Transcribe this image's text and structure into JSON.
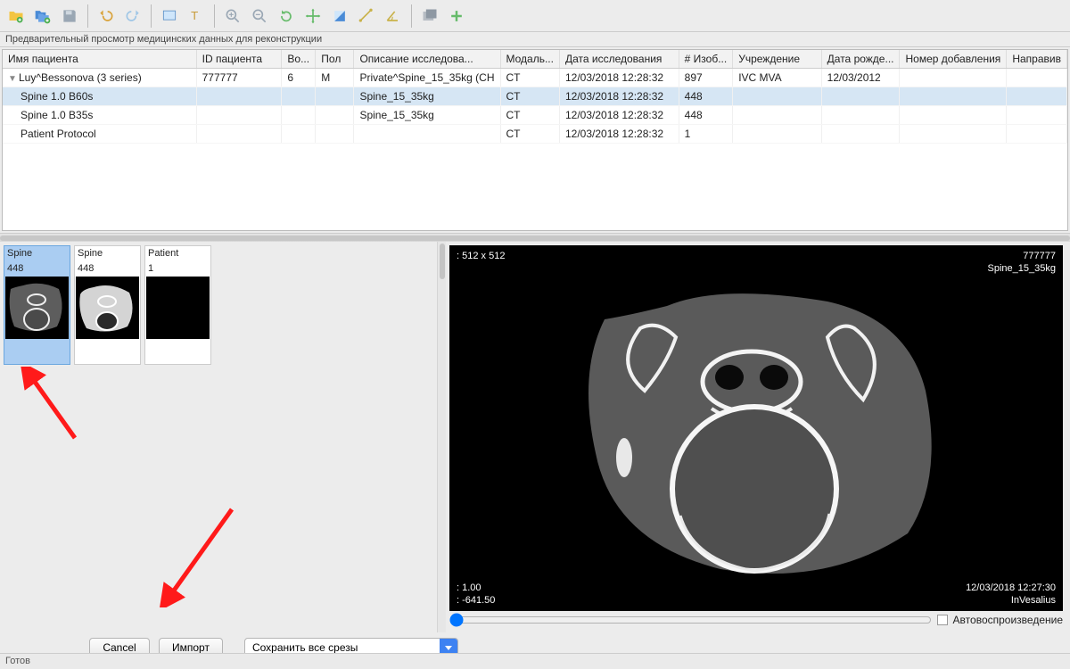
{
  "panel_title": "Предварительный просмотр медицинских данных для реконструкции",
  "columns": [
    "Имя пациента",
    "ID пациента",
    "Во...",
    "Пол",
    "Описание исследова...",
    "Модаль...",
    "Дата исследования",
    "# Изоб...",
    "Учреждение",
    "Дата рожде...",
    "Номер добавления",
    "Направив"
  ],
  "rows": [
    {
      "name": "Luy^Bessonova (3 series)",
      "id": "777777",
      "vo": "6",
      "pol": "M",
      "desc": "Private^Spine_15_35kg (CН",
      "mod": "CT",
      "date": "12/03/2018 12:28:32",
      "img": "897",
      "inst": "IVC MVA",
      "dob": "12/03/2012",
      "acc": "",
      "ref": "",
      "disclosure": true
    },
    {
      "name": "Spine  1.0  B60s",
      "id": "",
      "vo": "",
      "pol": "",
      "desc": "Spine_15_35kg",
      "mod": "CT",
      "date": "12/03/2018 12:28:32",
      "img": "448",
      "inst": "",
      "dob": "",
      "acc": "",
      "ref": "",
      "indent": true,
      "sel": true
    },
    {
      "name": "Spine  1.0  B35s",
      "id": "",
      "vo": "",
      "pol": "",
      "desc": "Spine_15_35kg",
      "mod": "CT",
      "date": "12/03/2018 12:28:32",
      "img": "448",
      "inst": "",
      "dob": "",
      "acc": "",
      "ref": "",
      "indent": true
    },
    {
      "name": "Patient Protocol",
      "id": "",
      "vo": "",
      "pol": "",
      "desc": "",
      "mod": "CT",
      "date": "12/03/2018 12:28:32",
      "img": "1",
      "inst": "",
      "dob": "",
      "acc": "",
      "ref": "",
      "indent": true
    }
  ],
  "thumbs": [
    {
      "title": "Spine",
      "count": "448",
      "sel": true,
      "variant": "ct1"
    },
    {
      "title": "Spine",
      "count": "448",
      "variant": "ct2"
    },
    {
      "title": "Patient",
      "count": "1",
      "variant": "blank"
    }
  ],
  "viewer": {
    "dim_label": ": 512 x 512",
    "patient_id": "777777",
    "series_label": "Spine_15_35kg",
    "slice_label": ": 1.00",
    "pos_label": ": -641.50",
    "date_label": "12/03/2018 12:27:30",
    "app_label": "InVesalius"
  },
  "autoplay_label": "Автовоспроизведение",
  "buttons": {
    "cancel": "Cancel",
    "import": "Импорт"
  },
  "save_select": "Сохранить все срезы",
  "status": "Готов"
}
